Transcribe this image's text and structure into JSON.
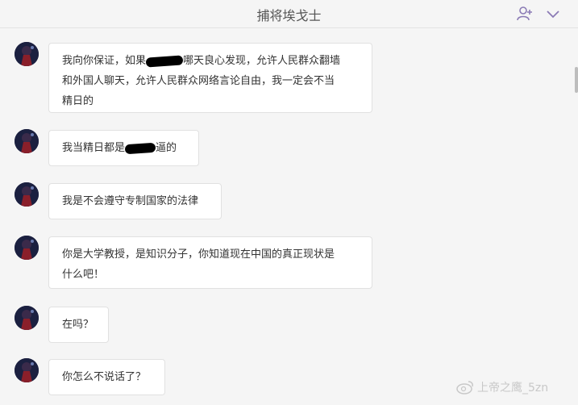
{
  "header": {
    "title": "捕将埃戈士",
    "icons": [
      "add-user-icon",
      "chevron-down-icon"
    ]
  },
  "messages": [
    {
      "lines": [
        "我向你保证，如果",
        "哪天良心发现，允许人民群众翻墙",
        "和外国人聊天，允许人民群众网络言论自由，我一定会不当",
        "精日的"
      ]
    },
    {
      "lines": [
        "我当精日都是",
        "逼的"
      ]
    },
    {
      "lines": [
        "我是不会遵守专制国家的法律"
      ]
    },
    {
      "lines": [
        "你是大学教授，是知识分子，你知道现在中国的真正现状是",
        "什么吧！"
      ]
    },
    {
      "lines": [
        "在吗？"
      ]
    },
    {
      "lines": [
        "你怎么不说话了？"
      ]
    }
  ],
  "watermark": {
    "text": "上帝之鹰_5zn",
    "icon": "weibo-icon"
  },
  "colors": {
    "background": "#f5f5f5",
    "bubble": "#ffffff",
    "header_text": "#555555",
    "icon": "#8b7bb5"
  }
}
